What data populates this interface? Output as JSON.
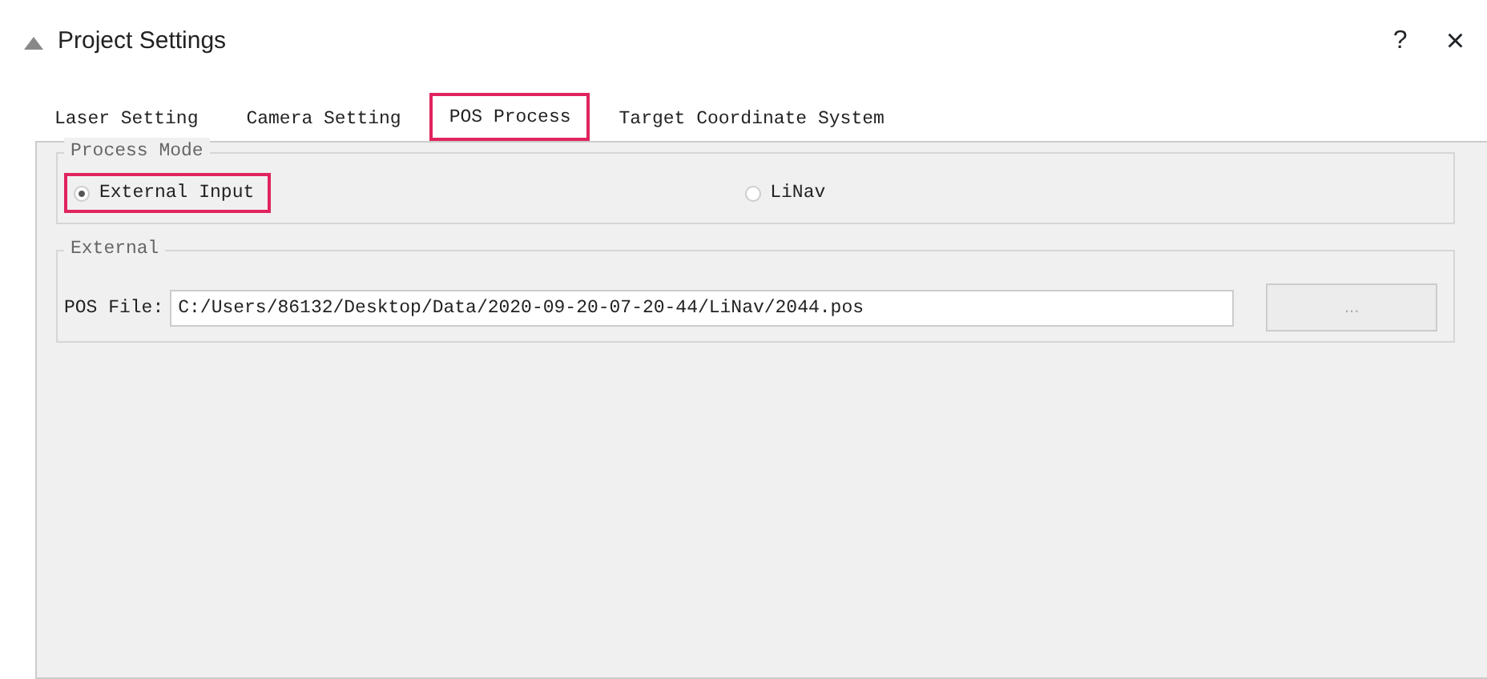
{
  "window": {
    "title": "Project Settings",
    "help": "?",
    "close": "×"
  },
  "tabs": [
    {
      "label": "Laser Setting",
      "selected": false,
      "highlighted": false
    },
    {
      "label": "Camera Setting",
      "selected": false,
      "highlighted": false
    },
    {
      "label": "POS Process",
      "selected": true,
      "highlighted": true
    },
    {
      "label": "Target Coordinate System",
      "selected": false,
      "highlighted": false
    }
  ],
  "process_mode": {
    "title": "Process Mode",
    "options": [
      {
        "label": "External Input",
        "selected": true,
        "highlighted": true
      },
      {
        "label": "LiNav",
        "selected": false,
        "highlighted": false
      }
    ]
  },
  "external": {
    "title": "External",
    "label": "POS File:",
    "value": "C:/Users/86132/Desktop/Data/2020-09-20-07-20-44/LiNav/2044.pos",
    "browse": "..."
  }
}
